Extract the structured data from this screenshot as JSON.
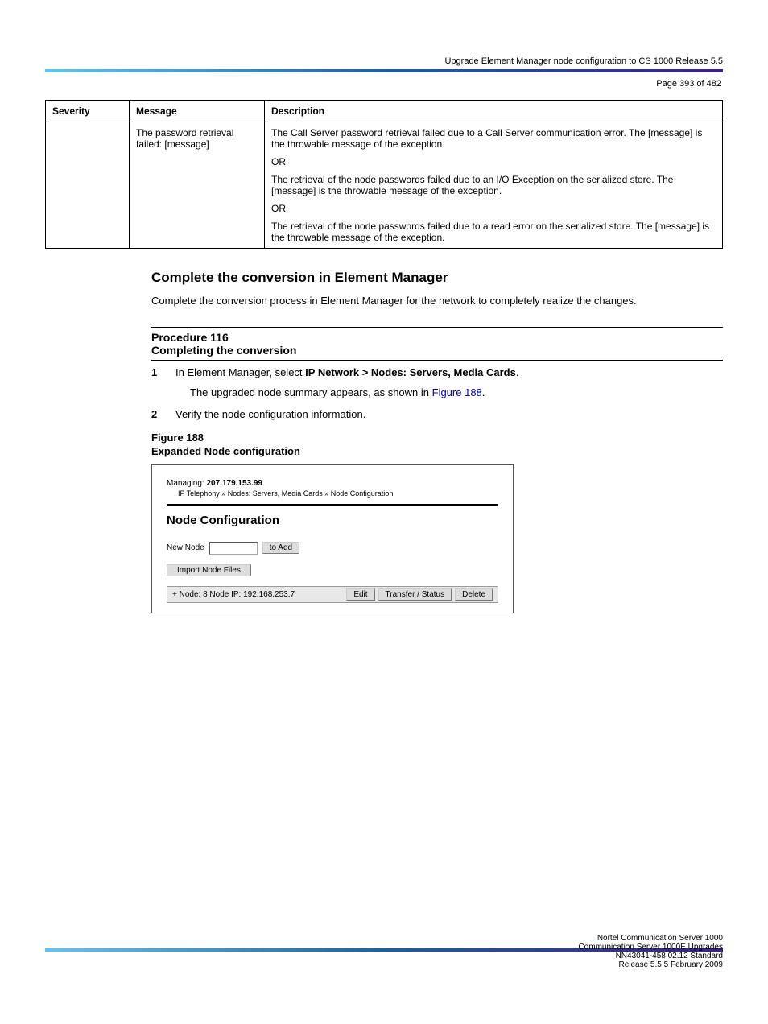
{
  "page_header_right": "Upgrade Element Manager node configuration to CS 1000 Release 5.5",
  "page_label_prefix": "Page ",
  "page_label_num": "393",
  "page_label_of": " of 482",
  "table": {
    "headers": [
      "Severity",
      "Message",
      "Description"
    ],
    "row": {
      "severity": "",
      "message": "The password retrieval failed: [message]",
      "description_lines": [
        "The Call Server password retrieval failed due to a Call Server communication error. The [message] is the throwable message of the exception.",
        "OR",
        "The retrieval of the node passwords failed due to an I/O Exception on the serialized store. The [message] is the throwable message of the exception.",
        "OR",
        "The retrieval of the node passwords failed due to a read error on the serialized store. The [message] is the throwable message of the exception."
      ]
    }
  },
  "section": {
    "heading": "Complete the conversion in Element Manager",
    "para1": "Complete the conversion process in Element Manager for the network to completely realize the changes.",
    "proc_label": "Procedure 116",
    "proc_title": "Completing the conversion",
    "steps": [
      {
        "n": "1",
        "text_a": "In Element Manager, select ",
        "bold_a": "IP Network > Nodes: Servers, Media Cards",
        "text_b": ".",
        "text_c": "The upgraded node summary appears, as shown in ",
        "link": "Figure 188",
        "text_d": "."
      },
      {
        "n": "2",
        "text_a": "Verify the node configuration information."
      }
    ],
    "figure_label": "Figure 188",
    "figure_title": "Expanded Node configuration"
  },
  "screenshot": {
    "managing_label": "Managing:",
    "managing_ip": "207.179.153.99",
    "breadcrumb": "IP Telephony » Nodes: Servers, Media Cards » Node Configuration",
    "heading": "Node Configuration",
    "new_node_label": "New Node",
    "to_add_btn": "to Add",
    "import_btn": "Import Node Files",
    "node_row_label": "+ Node: 8  Node IP: 192.168.253.7",
    "edit_btn": "Edit",
    "transfer_btn": "Transfer / Status",
    "delete_btn": "Delete"
  },
  "footer": {
    "line1": "Nortel Communication Server 1000",
    "line2": "Communication Server 1000E Upgrades",
    "line3": "NN43041-458 02.12 Standard",
    "line4": "Release 5.5 5 February 2009"
  }
}
